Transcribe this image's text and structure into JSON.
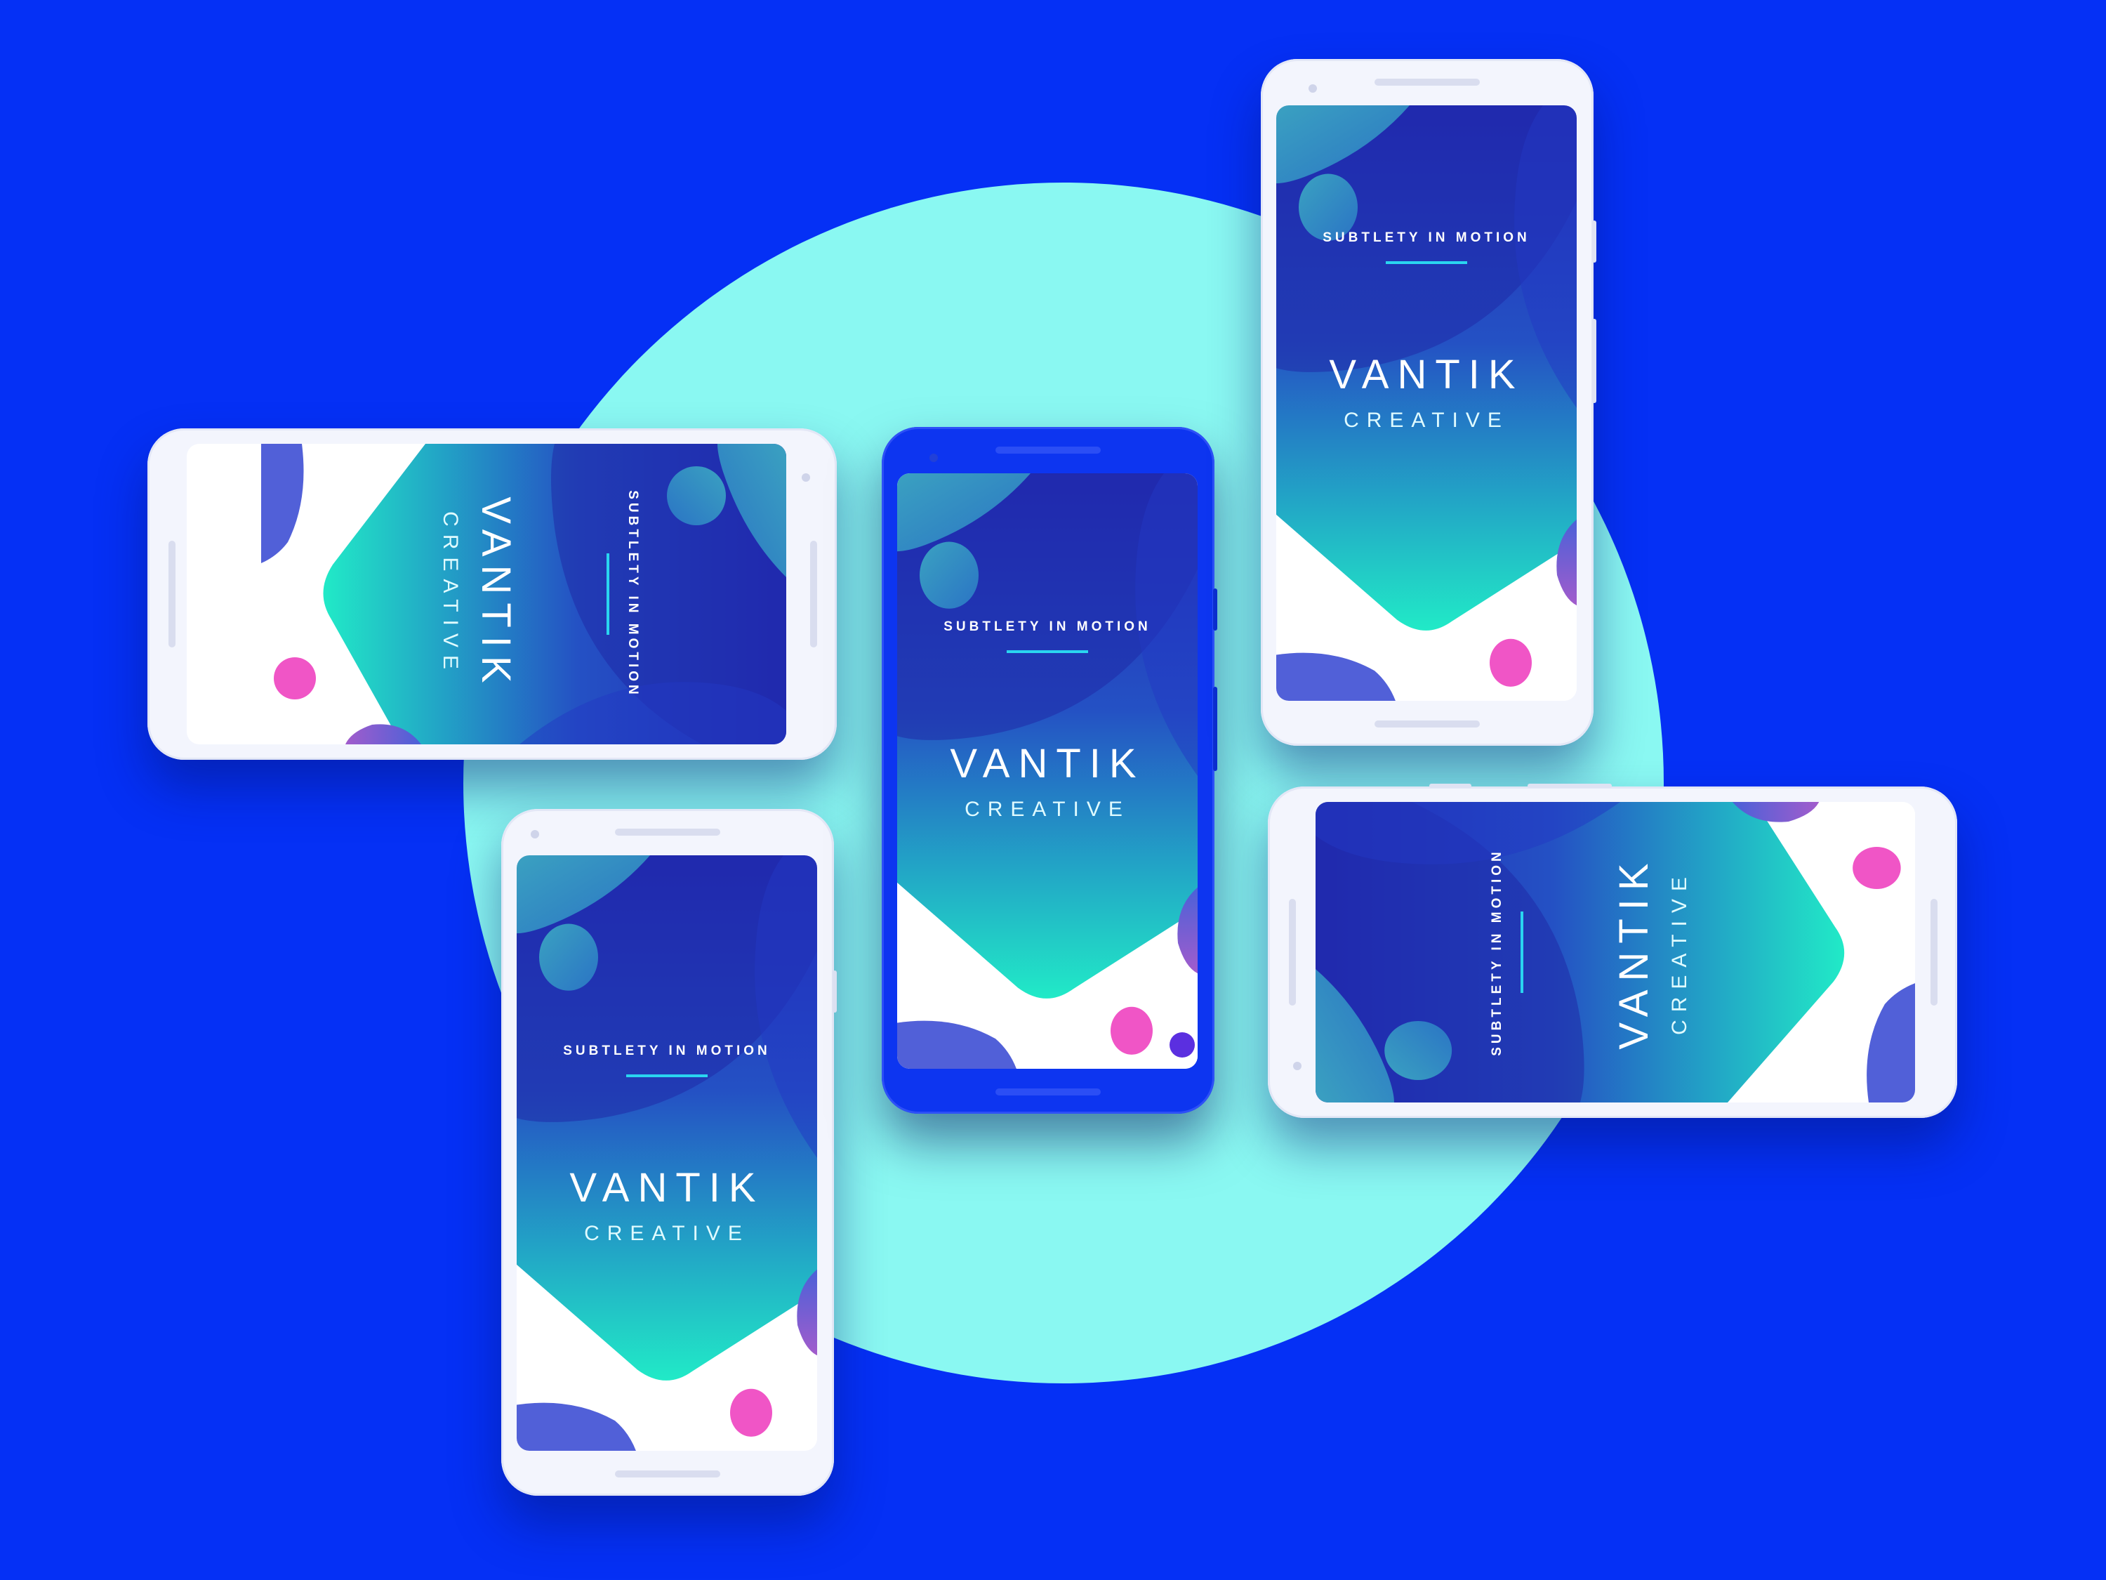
{
  "app": {
    "tagline": "SUBTLETY IN MOTION",
    "brand_title": "VANTIK",
    "brand_subtitle": "CREATIVE"
  },
  "colors": {
    "background": "#0530f5",
    "circle": "#8af8f2",
    "phone_white": "#f3f5fd",
    "phone_blue": "#0d35f0",
    "gradient_top": "#2029b8",
    "gradient_bottom": "#22e8c8",
    "accent_pink": "#f055c6",
    "accent_line": "#2ad5f0"
  },
  "icons": {
    "blob_decoration": "gradient-shape",
    "dot_decoration": "pink-circle"
  }
}
